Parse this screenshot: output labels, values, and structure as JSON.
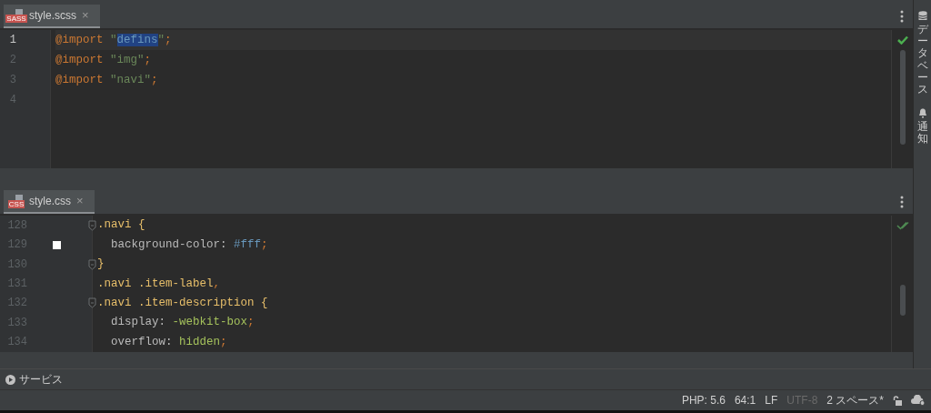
{
  "panes": [
    {
      "tab": {
        "label": "style.scss",
        "file_icon": "SASS",
        "close": "×",
        "selected": true
      },
      "status_icon": {
        "kind": "check"
      },
      "lines": [
        {
          "number": "1",
          "current": true,
          "fold": false,
          "tokens": [
            {
              "text": "@import",
              "kind": "keyword"
            },
            {
              "text": "\"",
              "kind": "string",
              "space_before": true
            },
            {
              "text": "defins",
              "kind": "string",
              "selected": true
            },
            {
              "text": "\"",
              "kind": "string"
            },
            {
              "text": ";",
              "kind": "keyword"
            }
          ]
        },
        {
          "number": "2",
          "current": false,
          "fold": false,
          "tokens": [
            {
              "text": "@import",
              "kind": "keyword"
            },
            {
              "text": "\"img\"",
              "kind": "string",
              "space_before": true
            },
            {
              "text": ";",
              "kind": "keyword"
            }
          ]
        },
        {
          "number": "3",
          "current": false,
          "fold": false,
          "tokens": [
            {
              "text": "@import",
              "kind": "keyword"
            },
            {
              "text": "\"navi\"",
              "kind": "string",
              "space_before": true
            },
            {
              "text": ";",
              "kind": "keyword"
            }
          ]
        },
        {
          "number": "4",
          "current": false,
          "fold": false
        }
      ]
    },
    {
      "tab": {
        "label": "style.css",
        "file_icon": "CSS",
        "close": "×",
        "selected": true
      },
      "status_icon": {
        "kind": "double-check"
      },
      "lines": [
        {
          "number": "128",
          "current": false,
          "fold": true,
          "tokens": [
            {
              "text": ".navi {",
              "kind": "selector"
            }
          ]
        },
        {
          "number": "129",
          "current": false,
          "fold": false,
          "color": "#ffffff",
          "tokens": [
            {
              "text": "  background-color: ",
              "kind": "property"
            },
            {
              "text": "#fff",
              "kind": "number"
            },
            {
              "text": ";",
              "kind": "keyword"
            }
          ]
        },
        {
          "number": "130",
          "current": false,
          "fold": true,
          "tokens": [
            {
              "text": "}",
              "kind": "selector"
            }
          ]
        },
        {
          "number": "131",
          "current": false,
          "fold": false,
          "tokens": [
            {
              "text": ".navi .item-label",
              "kind": "selector"
            },
            {
              "text": ",",
              "kind": "keyword"
            }
          ]
        },
        {
          "number": "132",
          "current": false,
          "fold": true,
          "tokens": [
            {
              "text": ".navi .item-description {",
              "kind": "selector"
            }
          ]
        },
        {
          "number": "133",
          "current": false,
          "fold": false,
          "tokens": [
            {
              "text": "  display: ",
              "kind": "property"
            },
            {
              "text": "-webkit-box",
              "kind": "value"
            },
            {
              "text": ";",
              "kind": "keyword"
            }
          ]
        },
        {
          "number": "134",
          "current": false,
          "fold": false,
          "tokens": [
            {
              "text": "  overflow: ",
              "kind": "property"
            },
            {
              "text": "hidden",
              "kind": "value"
            },
            {
              "text": ";",
              "kind": "keyword"
            }
          ]
        }
      ]
    }
  ],
  "side_strip": [
    {
      "label": "データベース",
      "kind": "database"
    },
    {
      "label": "通知",
      "kind": "bell"
    }
  ],
  "services": {
    "label": "サービス"
  },
  "status_bar": [
    {
      "text": "PHP: 5.6",
      "disabled": false
    },
    {
      "text": "64:1",
      "disabled": false
    },
    {
      "text": "LF",
      "disabled": false
    },
    {
      "text": "UTF-8",
      "disabled": true
    },
    {
      "text": "2 スペース*",
      "disabled": false
    }
  ]
}
